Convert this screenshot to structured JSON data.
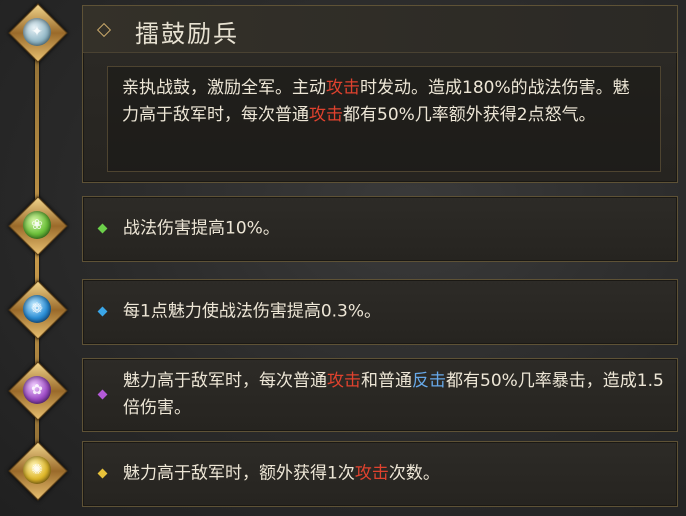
{
  "skill": {
    "title": "擂鼓励兵",
    "description": {
      "part1": "亲执战鼓，激励全军。主动",
      "highlight1": "攻击",
      "part2": "时发动。造成180%的战法伤害。魅力高于敌军时，每次普通",
      "highlight2": "攻击",
      "part3": "都有50%几率额外获得2点怒气。"
    }
  },
  "effects": [
    {
      "color": "#4caf3a",
      "icon": "green-gem-icon",
      "text": "战法伤害提高10%。"
    },
    {
      "color": "#2a8fd8",
      "icon": "blue-gem-icon",
      "text": "每1点魅力使战法伤害提高0.3%。"
    },
    {
      "color": "#a04ec8",
      "icon": "purple-gem-icon",
      "text_part1": "魅力高于敌军时，每次普通",
      "highlight_attack": "攻击",
      "text_part2": "和普通",
      "highlight_counter": "反击",
      "text_part3": "都有50%几率暴击，造成1.5倍伤害。"
    },
    {
      "color": "#e0b82a",
      "icon": "gold-gem-icon",
      "text_part1": "魅力高于敌军时，额外获得1次",
      "highlight_attack": "攻击",
      "text_part2": "次数。"
    }
  ],
  "colors": {
    "highlight_red": "#e0422e",
    "highlight_blue": "#67a8e8",
    "gold_frame": "#c89a4a"
  }
}
